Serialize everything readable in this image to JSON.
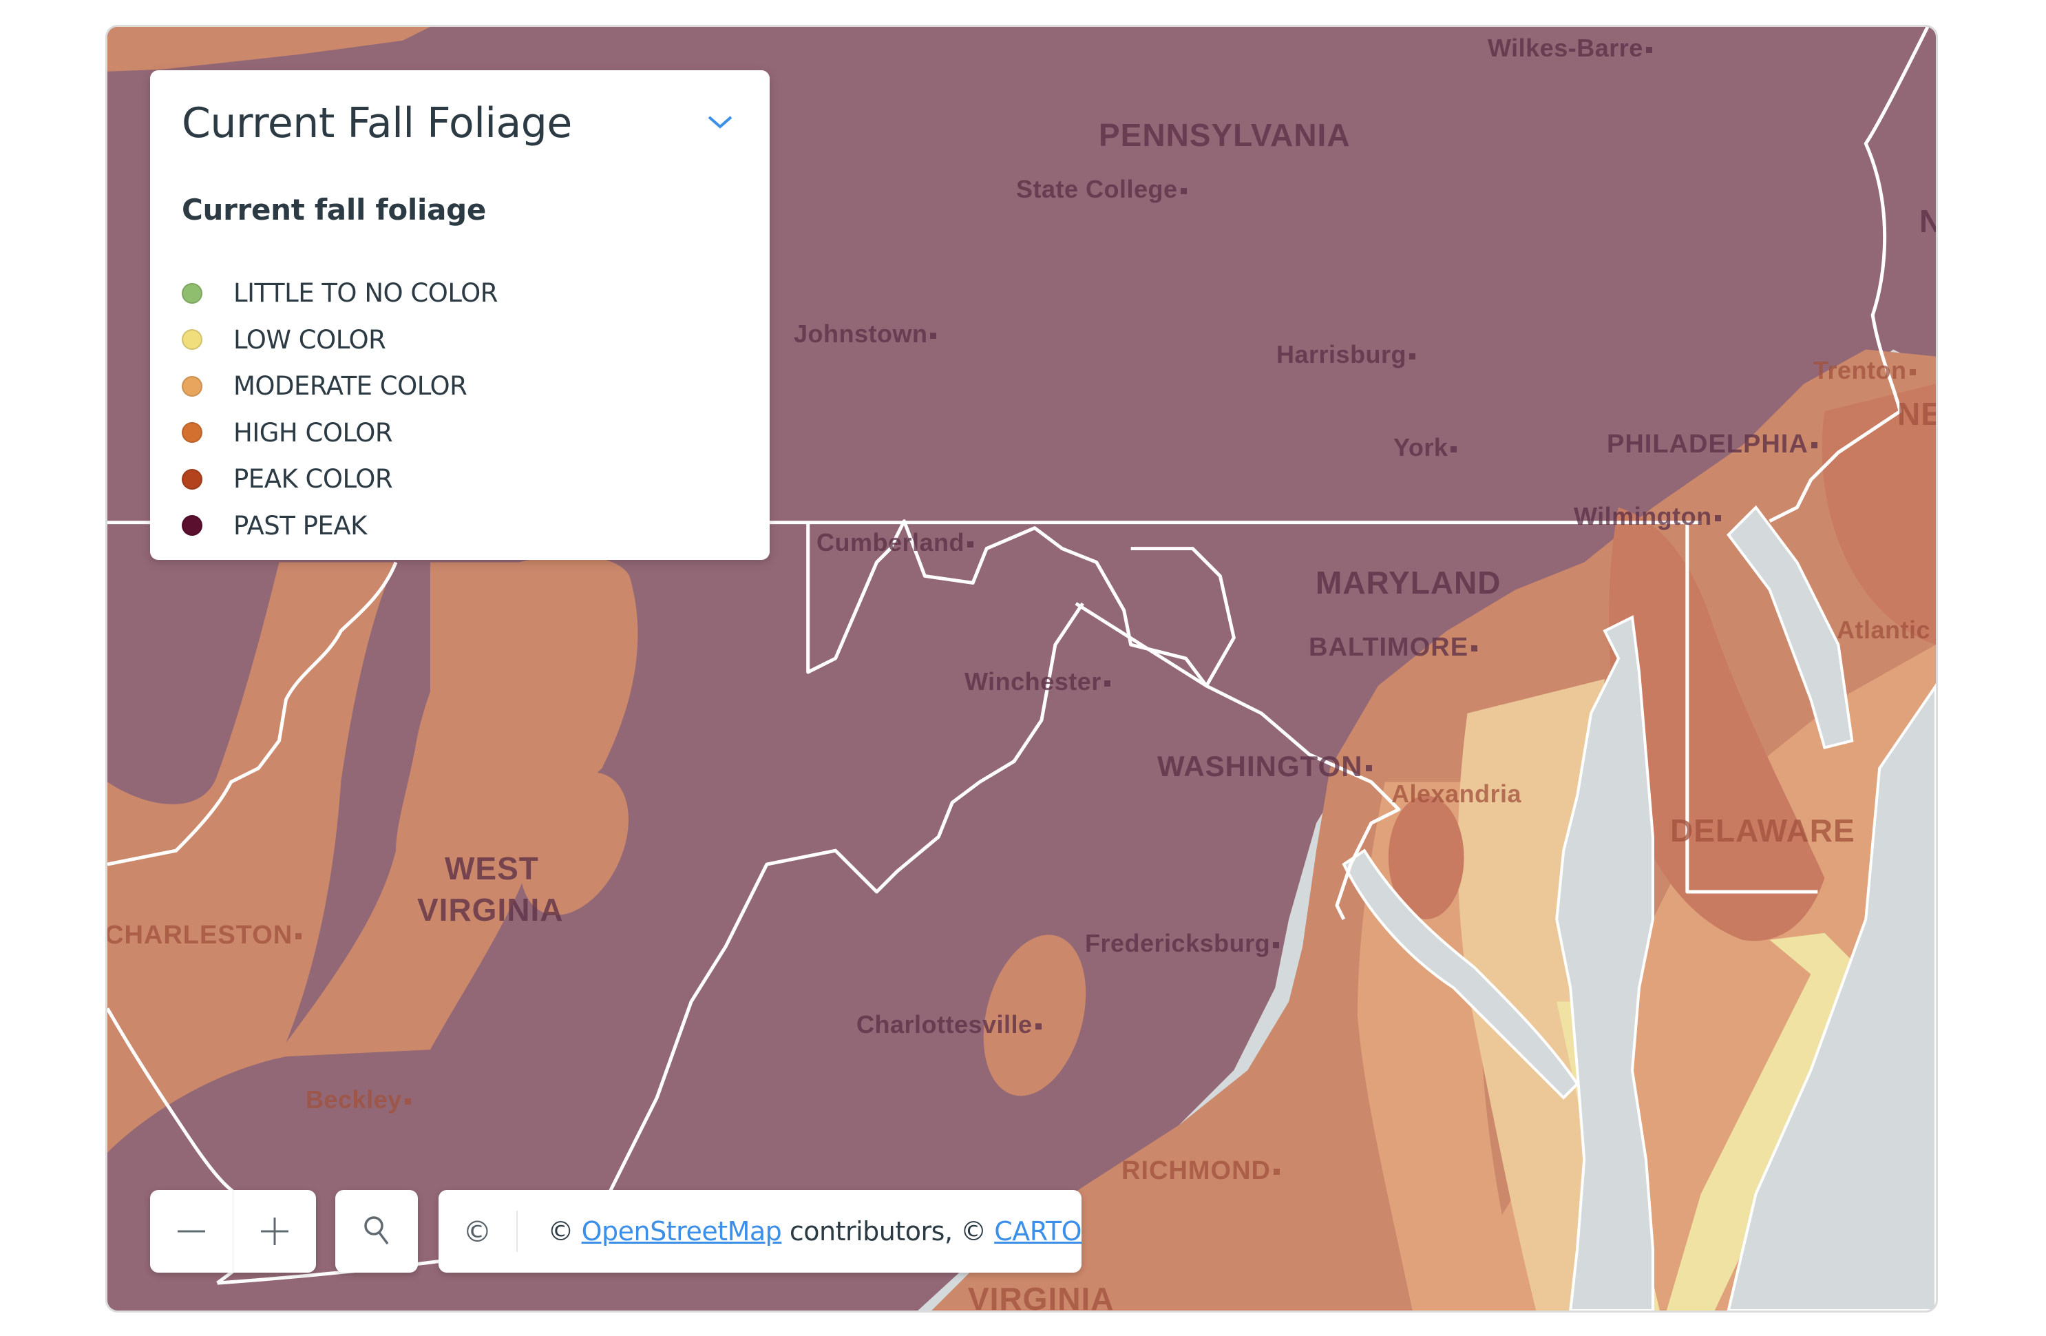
{
  "legend": {
    "title": "Current Fall Foliage",
    "collapse_icon": "chevron-down-icon",
    "subtitle": "Current fall foliage",
    "items": [
      {
        "label": "LITTLE TO NO COLOR",
        "color": "#8fbe6f"
      },
      {
        "label": "LOW COLOR",
        "color": "#f0dd7c"
      },
      {
        "label": "MODERATE COLOR",
        "color": "#e7a55e"
      },
      {
        "label": "HIGH COLOR",
        "color": "#d4702f"
      },
      {
        "label": "PEAK COLOR",
        "color": "#b2431c"
      },
      {
        "label": "PAST PEAK",
        "color": "#5a0f2e"
      }
    ]
  },
  "map": {
    "colors": {
      "past_peak_overlay": "#936876",
      "high_overlay": "#cc886b",
      "peak_overlay": "#c97b62",
      "moderate_overlay": "#e0a27a",
      "moderate_light_overlay": "#ecc898",
      "low_overlay": "#f0e2a2",
      "water": "#d4d9dc",
      "border": "#ffffff"
    },
    "labels": {
      "states": [
        "PENNSYLVANIA",
        "MARYLAND",
        "WEST",
        "VIRGINIA",
        "DELAWARE",
        "VIRGINIA",
        "NE",
        "N"
      ],
      "cities": [
        "Wilkes-Barre",
        "State College",
        "Johnstown",
        "Harrisburg",
        "Trenton",
        "York",
        "PHILADELPHIA",
        "Wilmington",
        "Cumberland",
        "BALTIMORE",
        "Atlantic",
        "Winchester",
        "WASHINGTON",
        "Alexandria",
        "CHARLESTON",
        "Fredericksburg",
        "Charlottesville",
        "Beckley",
        "RICHMOND"
      ]
    }
  },
  "controls": {
    "zoom_out_icon": "minus-icon",
    "zoom_in_icon": "plus-icon",
    "search_icon": "search-icon",
    "attribution_toggle": "©",
    "attribution": {
      "prefix": "© ",
      "osm_link": "OpenStreetMap",
      "middle": " contributors, © ",
      "carto_link": "CARTO"
    }
  }
}
